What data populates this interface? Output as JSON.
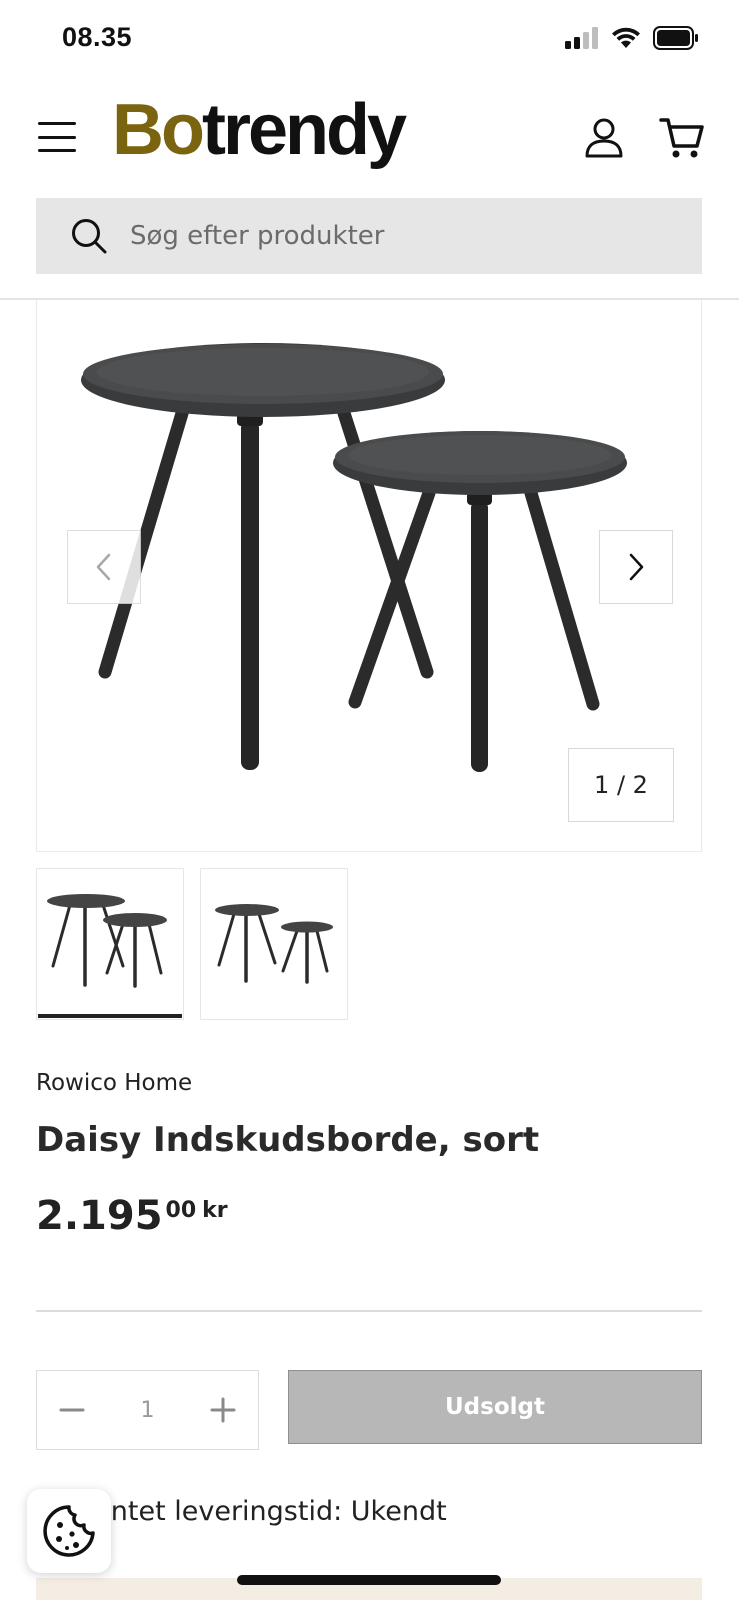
{
  "status_bar": {
    "time": "08.35"
  },
  "header": {
    "logo_part1": "Bo",
    "logo_part2": "trendy",
    "logo_color": "#7a6410"
  },
  "search": {
    "placeholder": "Søg efter produkter"
  },
  "gallery": {
    "counter": "1 / 2"
  },
  "product": {
    "vendor": "Rowico Home",
    "title": "Daisy Indskudsborde, sort",
    "price_main": "2.195",
    "price_cents": "00",
    "price_currency": "kr"
  },
  "quantity": {
    "value": "1"
  },
  "cart_button": {
    "label": "Udsolgt"
  },
  "delivery": {
    "text": "Forventet leveringstid: Ukendt"
  },
  "icons": {
    "menu": "hamburger-menu-icon",
    "account": "user-icon",
    "cart": "cart-icon",
    "search": "search-icon",
    "prev": "chevron-left-icon",
    "next": "chevron-right-icon",
    "minus": "minus-icon",
    "plus": "plus-icon",
    "cookie": "cookie-icon"
  }
}
